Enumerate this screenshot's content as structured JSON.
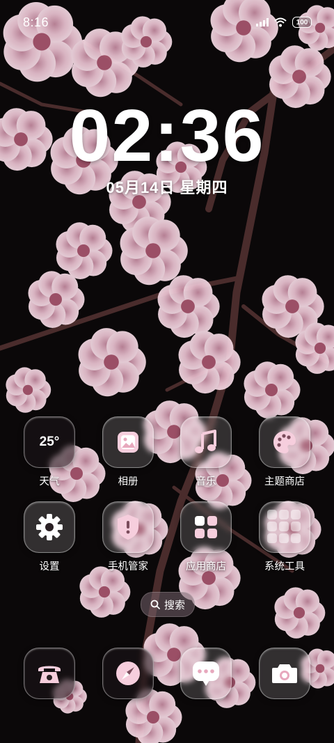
{
  "status_bar": {
    "time": "8:16",
    "battery": "100",
    "icons": [
      "signal-icon",
      "wifi-icon",
      "battery-icon"
    ]
  },
  "clock": {
    "time": "02:36",
    "date": "05月14日 星期四"
  },
  "apps": [
    {
      "label": "天气",
      "icon": "weather-icon",
      "value": "25°"
    },
    {
      "label": "相册",
      "icon": "gallery-icon"
    },
    {
      "label": "音乐",
      "icon": "music-icon"
    },
    {
      "label": "主题商店",
      "icon": "palette-icon"
    },
    {
      "label": "设置",
      "icon": "gear-icon"
    },
    {
      "label": "手机管家",
      "icon": "shield-icon"
    },
    {
      "label": "应用商店",
      "icon": "app-store-icon"
    },
    {
      "label": "系统工具",
      "icon": "folder-icon"
    }
  ],
  "search": {
    "label": "搜索"
  },
  "dock": [
    {
      "icon": "phone-icon"
    },
    {
      "icon": "browser-compass-icon"
    },
    {
      "icon": "messages-icon"
    },
    {
      "icon": "camera-icon"
    }
  ],
  "colors": {
    "accent_pink": "#f6cedd",
    "background": "#0b0809",
    "blossom": "#e6b4c6"
  }
}
